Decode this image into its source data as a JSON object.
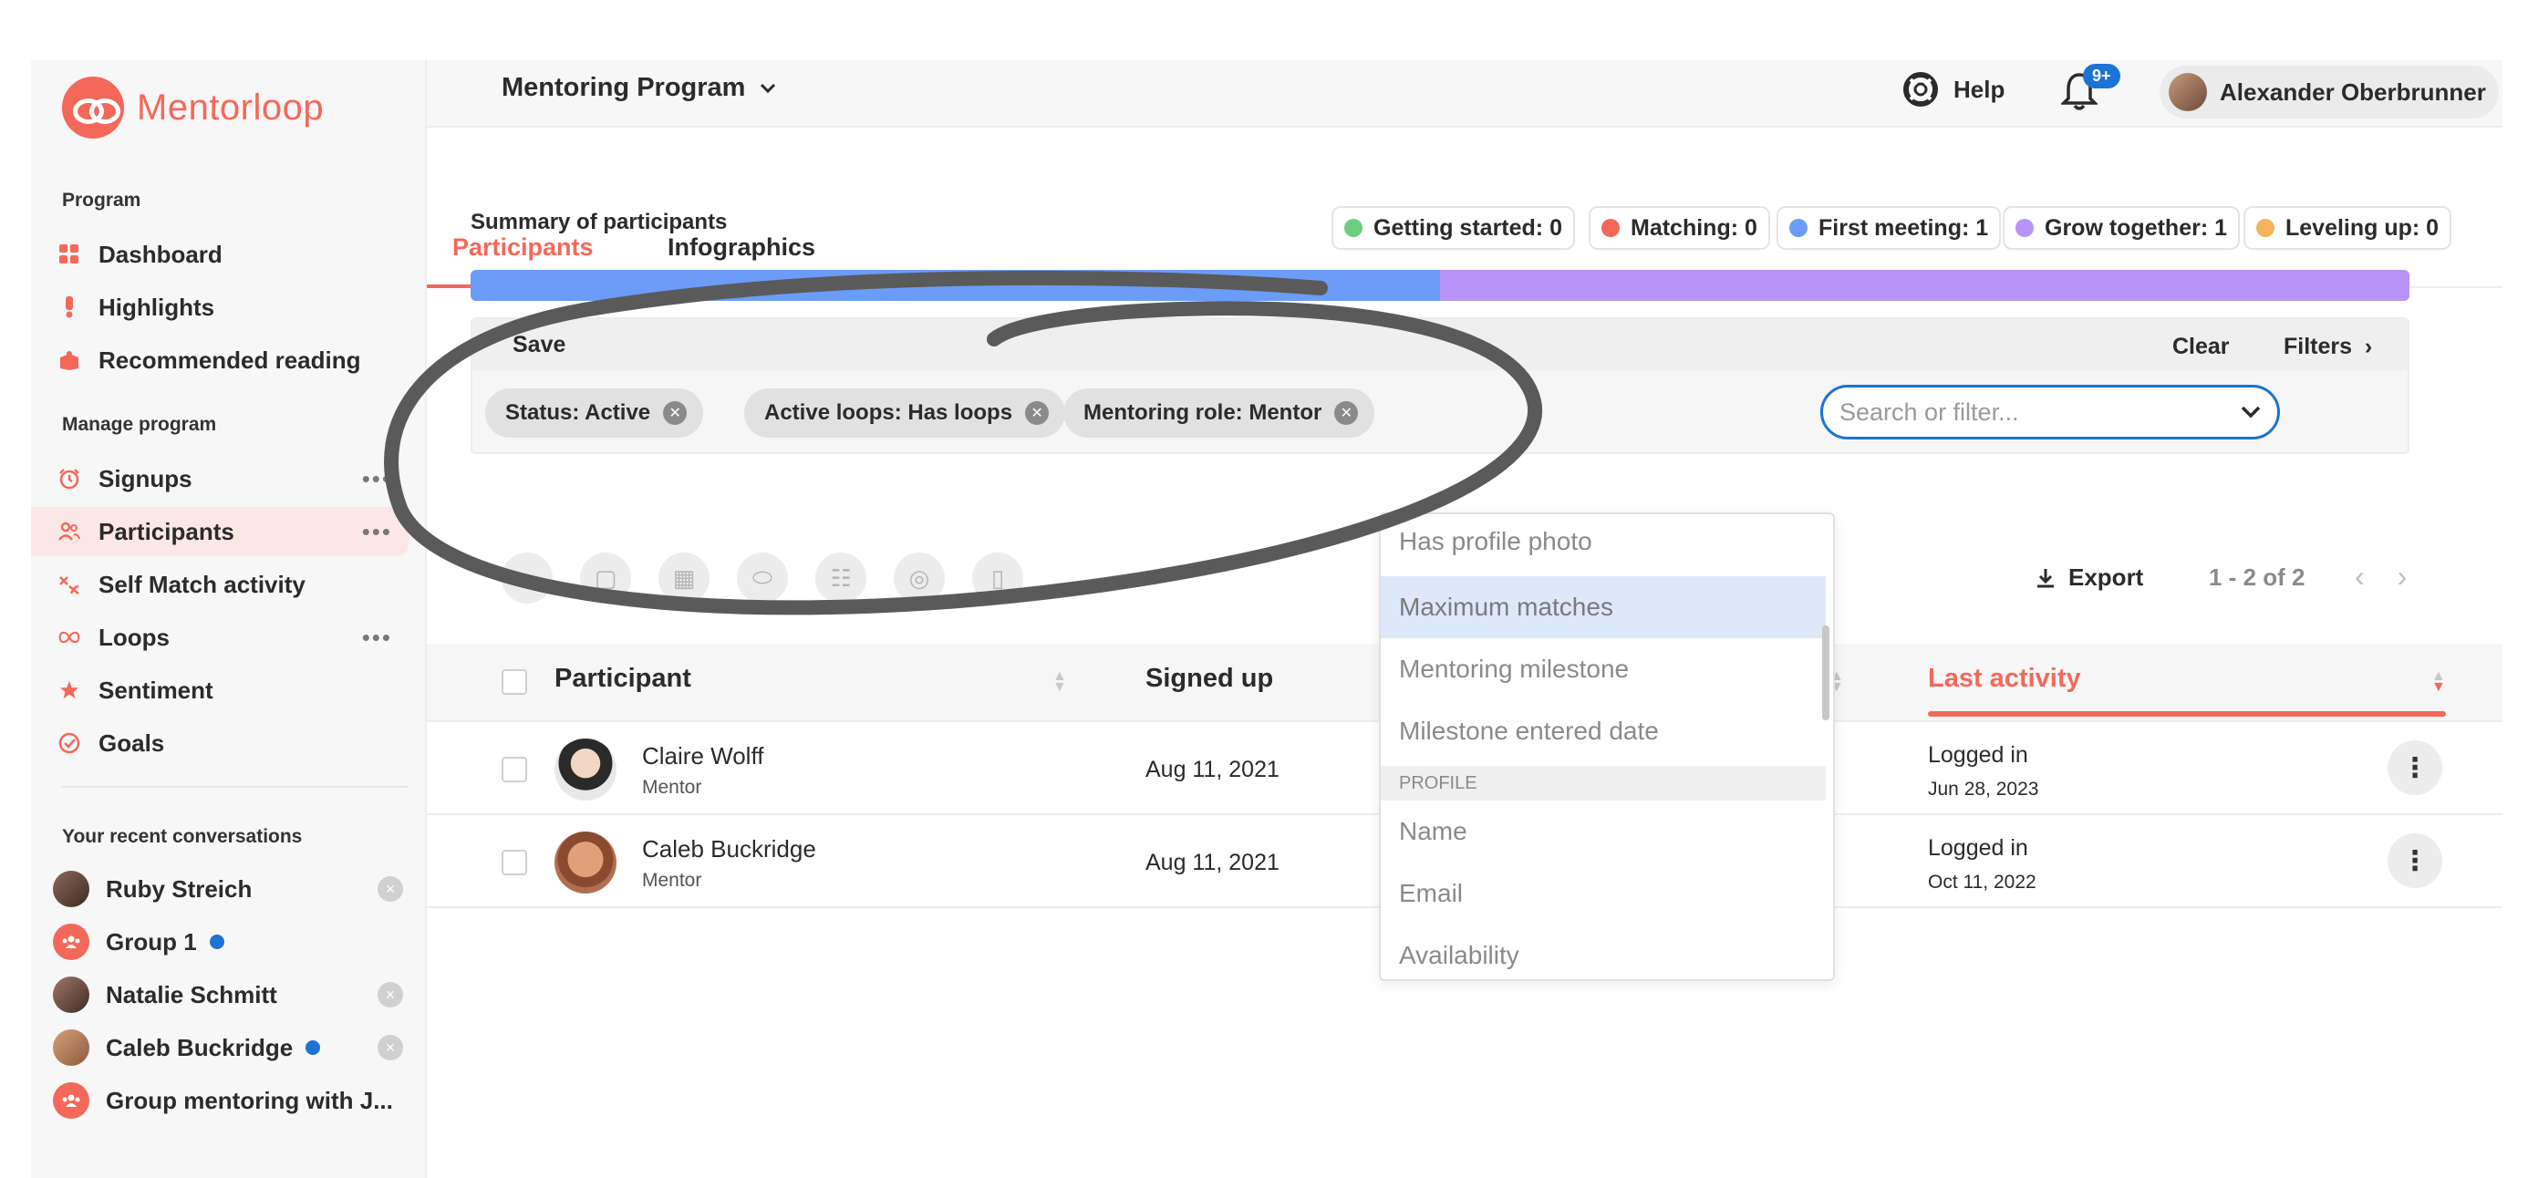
{
  "brand": {
    "name": "Mentorloop",
    "color": "#f4685a"
  },
  "sidebar": {
    "program_label": "Program",
    "program_items": [
      {
        "label": "Dashboard",
        "icon": "grid-icon"
      },
      {
        "label": "Highlights",
        "icon": "exclamation-icon"
      },
      {
        "label": "Recommended reading",
        "icon": "book-icon"
      }
    ],
    "manage_label": "Manage program",
    "manage_items": [
      {
        "label": "Signups",
        "icon": "alarm-icon",
        "more": "•••"
      },
      {
        "label": "Participants",
        "icon": "people-icon",
        "more": "•••",
        "active": true
      },
      {
        "label": "Self Match activity",
        "icon": "match-icon"
      },
      {
        "label": "Loops",
        "icon": "infinity-icon",
        "more": "•••"
      },
      {
        "label": "Sentiment",
        "icon": "star-icon"
      },
      {
        "label": "Goals",
        "icon": "check-circle-icon"
      }
    ],
    "conversations_label": "Your recent conversations",
    "conversations": [
      {
        "label": "Ruby Streich",
        "close": "×"
      },
      {
        "label": "Group 1",
        "unread": true
      },
      {
        "label": "Natalie Schmitt",
        "close": "×"
      },
      {
        "label": "Caleb Buckridge",
        "unread": true,
        "close": "×"
      },
      {
        "label": "Group mentoring with J..."
      }
    ]
  },
  "header": {
    "program_title": "Mentoring Program",
    "help_label": "Help",
    "notification_badge": "9+",
    "user_name": "Alexander Oberbrunner"
  },
  "tabs": [
    {
      "label": "Participants",
      "active": true
    },
    {
      "label": "Infographics"
    }
  ],
  "summary": {
    "label": "Summary of participants",
    "legend": [
      {
        "label": "Getting started: 0",
        "color": "#6ccf7f"
      },
      {
        "label": "Matching: 0",
        "color": "#f4685a"
      },
      {
        "label": "First meeting: 1",
        "color": "#6b9cf7"
      },
      {
        "label": "Grow together: 1",
        "color": "#b894f7"
      },
      {
        "label": "Leveling up: 0",
        "color": "#f5b35a"
      }
    ],
    "progress": [
      {
        "stage": "First meeting",
        "fraction": 0.5,
        "color": "#6b9cf7"
      },
      {
        "stage": "Grow together",
        "fraction": 0.5,
        "color": "#b894f7"
      }
    ]
  },
  "filters": {
    "save_label": "Save",
    "clear_label": "Clear",
    "filters_label": "Filters",
    "chips": [
      "Status: Active",
      "Active loops: Has loops",
      "Mentoring role: Mentor"
    ],
    "search_placeholder": "Search or filter...",
    "dropdown": [
      {
        "label": "Has profile photo"
      },
      {
        "label": "Maximum matches",
        "highlighted": true
      },
      {
        "label": "Mentoring milestone"
      },
      {
        "label": "Milestone entered date"
      },
      {
        "group": "PROFILE"
      },
      {
        "label": "Name"
      },
      {
        "label": "Email"
      },
      {
        "label": "Availability"
      }
    ]
  },
  "toolbar": {
    "export_label": "Export",
    "pager_text": "1 - 2 of 2"
  },
  "table": {
    "columns": [
      "Participant",
      "Signed up",
      "Last activity"
    ],
    "rows": [
      {
        "name": "Claire Wolff",
        "role": "Mentor",
        "signed_up": "Aug 11, 2021",
        "activity": "Logged in",
        "activity_date": "Jun 28, 2023"
      },
      {
        "name": "Caleb Buckridge",
        "role": "Mentor",
        "signed_up": "Aug 11, 2021",
        "activity": "Logged in",
        "activity_date": "Oct 11, 2022"
      }
    ]
  }
}
